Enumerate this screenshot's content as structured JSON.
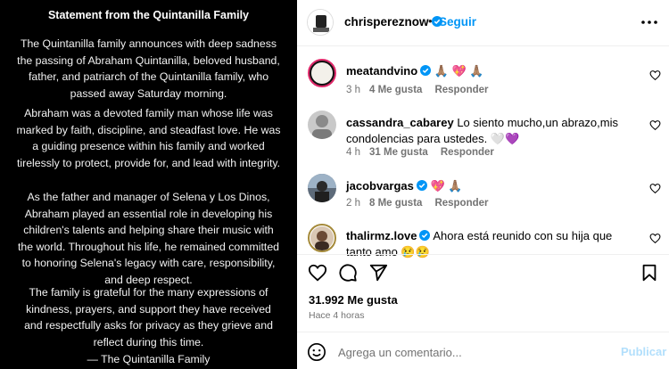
{
  "statement": {
    "title": "Statement from the Quintanilla Family",
    "paragraphs": [
      "The Quintanilla family announces with deep sadness the passing of Abraham Quintanilla, beloved husband, father, and patriarch of the Quintanilla family, who passed away Saturday morning.",
      "Abraham was a devoted family man whose life was marked by faith, discipline, and steadfast love. He was a guiding presence within his family and worked tirelessly to protect, provide for, and lead with integrity.",
      "As the father and manager of Selena y Los Dinos, Abraham played an essential role in developing his children's talents and helping share their music with the world. Throughout his life, he remained committed to honoring Selena's legacy with care, responsibility, and deep respect.",
      "The family is grateful for the many expressions of kindness, prayers, and support they have received and respectfully asks for privacy as they grieve and reflect during this time."
    ],
    "signoff": "— The Quintanilla Family"
  },
  "header": {
    "username": "chrispereznow",
    "separator": "•",
    "follow_label": "Seguir"
  },
  "comments": [
    {
      "username": "meatandvino",
      "text": "🙏🏽 💖 🙏🏽",
      "time": "3 h",
      "likes": "4 Me gusta",
      "reply": "Responder"
    },
    {
      "username": "cassandra_cabarey",
      "text": "Lo siento mucho,un abrazo,mis condolencias para ustedes. 🤍💜",
      "time": "4 h",
      "likes": "31 Me gusta",
      "reply": "Responder"
    },
    {
      "username": "jacobvargas",
      "text": "💖 🙏🏽",
      "time": "2 h",
      "likes": "8 Me gusta",
      "reply": "Responder"
    },
    {
      "username": "thalirmz.love",
      "text": "Ahora está reunido con su hija que tanto amo 😢😢",
      "time": "",
      "likes": "",
      "reply": ""
    }
  ],
  "post": {
    "likes": "31.992 Me gusta",
    "time": "Hace 4 horas",
    "comment_placeholder": "Agrega un comentario...",
    "publish_label": "Publicar"
  },
  "colors": {
    "accent": "#0095f6",
    "verified": "#0095f6",
    "publish_disabled": "#b2dffc",
    "muted": "#737373"
  },
  "icons": [
    "verified-icon",
    "more-options-icon",
    "heart-icon",
    "comment-icon",
    "share-icon",
    "bookmark-icon",
    "emoji-icon"
  ]
}
